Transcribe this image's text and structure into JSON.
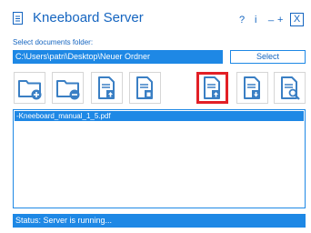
{
  "window": {
    "title": "Kneeboard Server",
    "controls": {
      "help": "?",
      "info": "i",
      "minimize": "_",
      "maximize": "+",
      "close": "X"
    }
  },
  "folder": {
    "label": "Select documents folder:",
    "path": "C:\\Users\\patri\\Desktop\\Neuer Ordner",
    "select_label": "Select"
  },
  "toolbar": {
    "buttons": [
      {
        "icon": "folder-add-icon"
      },
      {
        "icon": "folder-remove-icon"
      },
      {
        "icon": "document-upload-icon"
      },
      {
        "icon": "document-delete-icon"
      },
      {
        "icon": "document-upload-icon",
        "highlighted": true
      },
      {
        "icon": "document-download-icon"
      },
      {
        "icon": "document-search-icon"
      }
    ]
  },
  "files": [
    "-Kneeboard_manual_1_5.pdf"
  ],
  "status": "Status: Server is running...",
  "colors": {
    "accent": "#1e88e5",
    "title": "#1565c0",
    "icon": "#3a7fc4",
    "highlight": "#e21f26"
  }
}
